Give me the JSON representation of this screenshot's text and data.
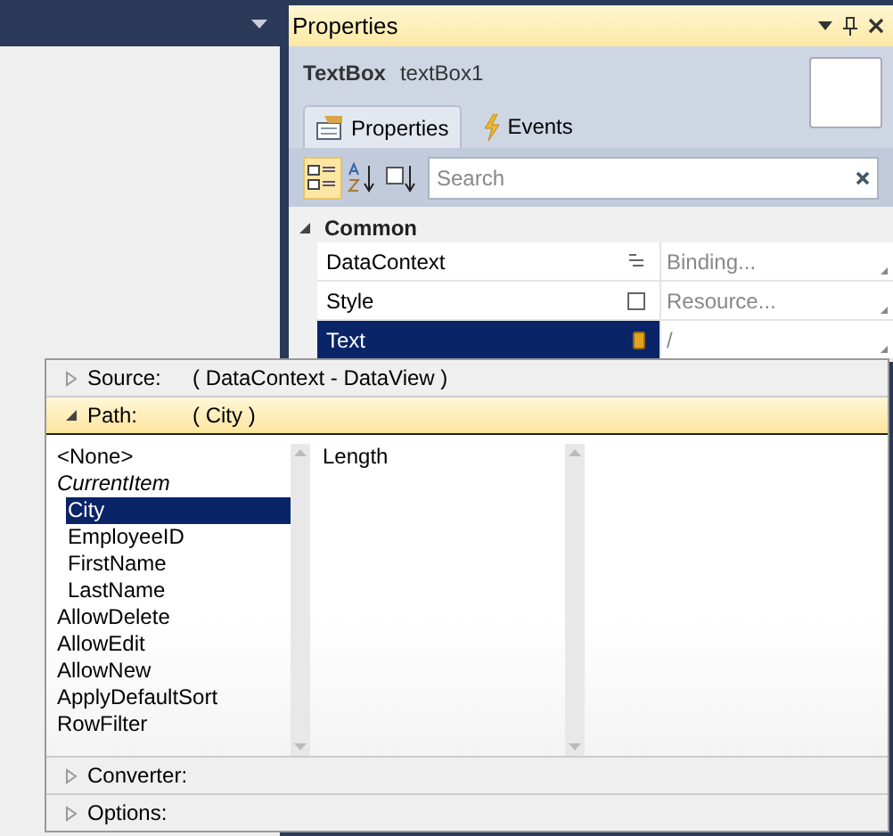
{
  "properties_panel": {
    "title": "Properties",
    "element_type": "TextBox",
    "element_name": "textBox1",
    "tabs": [
      {
        "label": "Properties",
        "selected": true
      },
      {
        "label": "Events",
        "selected": false
      }
    ],
    "view_buttons": [
      {
        "kind": "categorized",
        "selected": true
      },
      {
        "kind": "alphabetical",
        "selected": false
      },
      {
        "kind": "sortsource",
        "selected": false
      }
    ],
    "search": {
      "placeholder": "Search"
    },
    "category": {
      "label": "Common",
      "expanded": true
    },
    "rows": [
      {
        "name": "DataContext",
        "kind": "binding",
        "value": "Binding...",
        "selected": false
      },
      {
        "name": "Style",
        "kind": "resource",
        "value": "Resource...",
        "selected": false
      },
      {
        "name": "Text",
        "kind": "local",
        "value": "/",
        "selected": true
      }
    ]
  },
  "binding_popup": {
    "sections": [
      {
        "label": "Source:",
        "value": "( DataContext - DataView )",
        "expanded": false
      },
      {
        "label": "Path:",
        "value": "( City )",
        "expanded": true
      }
    ],
    "path_list": [
      {
        "label": "<None>",
        "kind": "item",
        "selected": false
      },
      {
        "label": "CurrentItem",
        "kind": "collection",
        "selected": false,
        "children": [
          {
            "label": "City",
            "kind": "item",
            "selected": true
          },
          {
            "label": "EmployeeID",
            "kind": "item",
            "selected": false
          },
          {
            "label": "FirstName",
            "kind": "item",
            "selected": false
          },
          {
            "label": "LastName",
            "kind": "item",
            "selected": false
          }
        ]
      },
      {
        "label": "AllowDelete",
        "kind": "item",
        "selected": false
      },
      {
        "label": "AllowEdit",
        "kind": "item",
        "selected": false
      },
      {
        "label": "AllowNew",
        "kind": "item",
        "selected": false
      },
      {
        "label": "ApplyDefaultSort",
        "kind": "item",
        "selected": false
      },
      {
        "label": "RowFilter",
        "kind": "item",
        "selected": false
      }
    ],
    "member_list": [
      {
        "label": "Length",
        "selected": false
      }
    ],
    "footer_sections": [
      {
        "label": "Converter:",
        "expanded": false
      },
      {
        "label": "Options:",
        "expanded": false
      }
    ]
  }
}
